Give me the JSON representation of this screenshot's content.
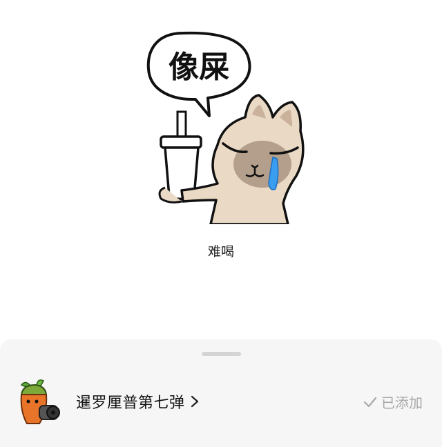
{
  "sticker": {
    "bubble_text": "像屎",
    "icon": "crying-cat-holding-drink-sticker",
    "caption": "难喝"
  },
  "pack": {
    "icon": "carrot-soldier-thumbnail",
    "title": "暹罗厘普第七弹",
    "chevron_icon": "chevron-right-icon",
    "status_icon": "checkmark-icon",
    "status_label": "已添加"
  },
  "colors": {
    "background": "#ffffff",
    "sheet": "#f6f6f6",
    "handle": "#d4d4d4",
    "status_gray": "#a8a8a8",
    "tear_blue": "#3a9df0",
    "cat_fur": "#ead9c5",
    "cat_mask": "#b49e8c"
  }
}
